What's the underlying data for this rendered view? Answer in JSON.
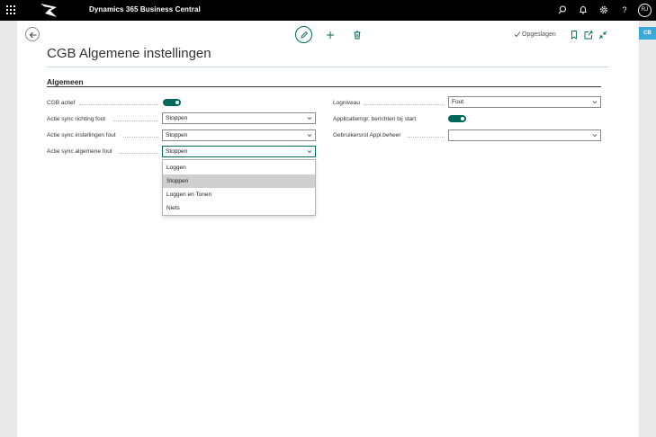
{
  "topbar": {
    "app_title": "Dynamics 365 Business Central",
    "avatar_initials": "RJ",
    "icons": [
      "waffle-icon",
      "logo-icon",
      "search-icon",
      "bell-icon",
      "gear-icon",
      "help-icon"
    ]
  },
  "side_badge": "CB",
  "actions": {
    "icons": [
      "back-arrow-icon",
      "edit-icon",
      "add-icon",
      "delete-icon",
      "bookmark-icon",
      "open-new-window-icon",
      "collapse-icon"
    ],
    "status": "Opgeslagen"
  },
  "page": {
    "title": "CGB Algemene instellingen",
    "section": "Algemeen"
  },
  "fields_left": [
    {
      "label": "CGB actief",
      "type": "toggle",
      "value": "on"
    },
    {
      "label": "Actie sync richting fout",
      "type": "select",
      "value": "Stoppen"
    },
    {
      "label": "Actie sync instellingen fout",
      "type": "select",
      "value": "Stoppen"
    },
    {
      "label": "Actie sync algemene fout",
      "type": "select",
      "value": "Stoppen"
    }
  ],
  "fields_right": [
    {
      "label": "Logniveau",
      "type": "select",
      "value": "Fout"
    },
    {
      "label": "Applicatiemgr. berichten bij start",
      "type": "toggle",
      "value": "on"
    },
    {
      "label": "Gebruikersrol Appl.beheer",
      "type": "select",
      "value": ""
    }
  ],
  "dropdown": {
    "options": [
      "Loggen",
      "Stoppen",
      "Loggen en Tonen",
      "Niets"
    ],
    "selected": "Stoppen"
  },
  "colors": {
    "accent": "#00695c",
    "topbar": "#000000",
    "badge": "#3aa8d8"
  }
}
